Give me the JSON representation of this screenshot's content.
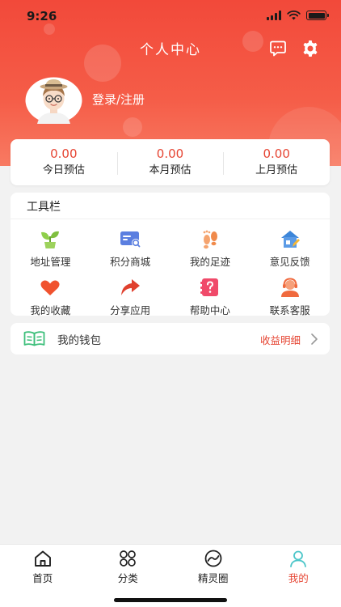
{
  "status_bar": {
    "time": "9:26"
  },
  "header": {
    "title": "个人中心",
    "message_icon": "message-icon",
    "settings_icon": "gear-icon"
  },
  "profile": {
    "login_text": "登录/注册"
  },
  "stats": [
    {
      "value": "0.00",
      "label": "今日预估"
    },
    {
      "value": "0.00",
      "label": "本月预估"
    },
    {
      "value": "0.00",
      "label": "上月预估"
    }
  ],
  "toolbar": {
    "title": "工具栏",
    "items": [
      {
        "label": "地址管理",
        "icon": "plant-icon",
        "color": "#7fbf3f"
      },
      {
        "label": "积分商城",
        "icon": "card-icon",
        "color": "#5b7fe0"
      },
      {
        "label": "我的足迹",
        "icon": "footprint-icon",
        "color": "#f08a4b"
      },
      {
        "label": "意见反馈",
        "icon": "house-edit-icon",
        "color": "#3d86d9"
      },
      {
        "label": "我的收藏",
        "icon": "heart-icon",
        "color": "#f0522e"
      },
      {
        "label": "分享应用",
        "icon": "share-icon",
        "color": "#e0402e"
      },
      {
        "label": "帮助中心",
        "icon": "help-icon",
        "color": "#f04a6a"
      },
      {
        "label": "联系客服",
        "icon": "support-icon",
        "color": "#f06a3e"
      }
    ]
  },
  "wallet": {
    "label": "我的钱包",
    "detail_link": "收益明细",
    "icon": "wallet-book-icon",
    "icon_color": "#3cbf7a"
  },
  "tab_bar": {
    "items": [
      {
        "label": "首页",
        "icon": "home-icon"
      },
      {
        "label": "分类",
        "icon": "category-icon"
      },
      {
        "label": "精灵圈",
        "icon": "circle-icon"
      },
      {
        "label": "我的",
        "icon": "profile-icon"
      }
    ],
    "active_color": "#e64533",
    "profile_icon_color": "#4cc6c9"
  },
  "colors": {
    "brand": "#f2493a",
    "accent_text": "#e64533",
    "background": "#f2f2f2"
  }
}
